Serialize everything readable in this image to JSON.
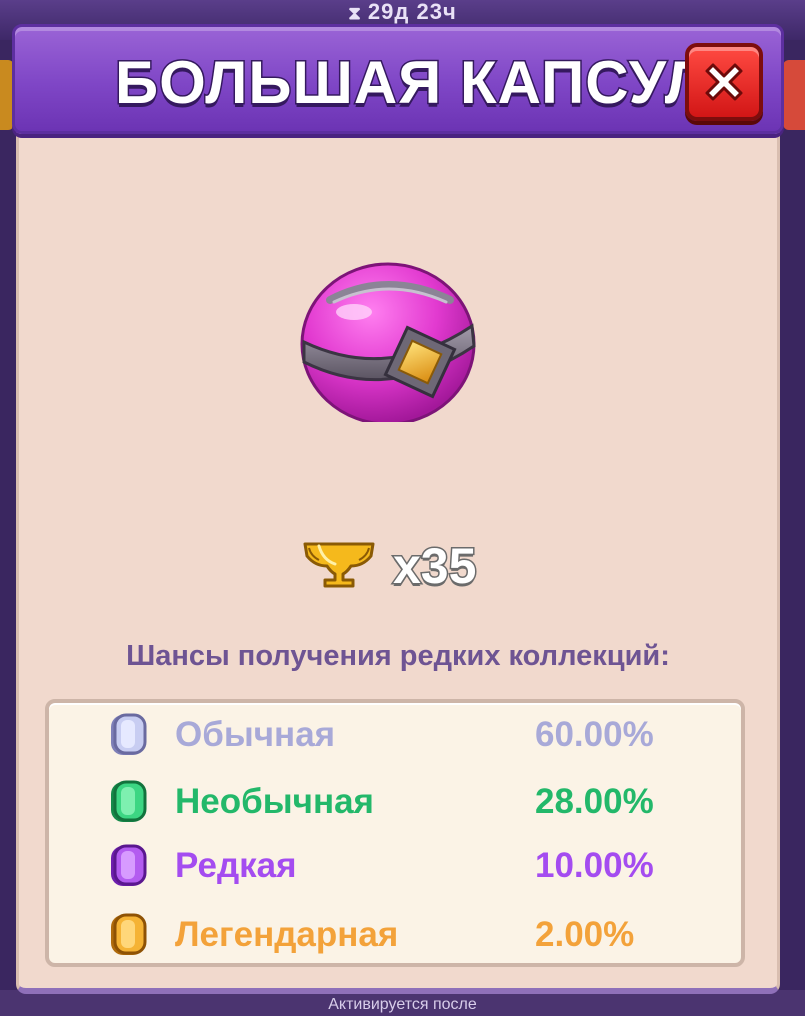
{
  "background": {
    "timer_text": "29д 23ч",
    "bottom_text": "Активируется после"
  },
  "modal": {
    "title": "БОЛЬШАЯ КАПСУЛА",
    "close_icon": "close-x-icon",
    "item_icon": "capsule-icon",
    "reward": {
      "icon": "trophy-icon",
      "count_label": "x35"
    },
    "chances_heading": "Шансы получения редких коллекций:",
    "rarities": [
      {
        "name": "Обычная",
        "chance": "60.00%",
        "color": "#a8a9d8",
        "gem_color": "#c8cdf2",
        "icon": "gem-common-icon"
      },
      {
        "name": "Необычная",
        "chance": "28.00%",
        "color": "#23b86a",
        "gem_color": "#3cd683",
        "icon": "gem-uncommon-icon"
      },
      {
        "name": "Редкая",
        "chance": "10.00%",
        "color": "#a44cf0",
        "gem_color": "#b35cf0",
        "icon": "gem-rare-icon"
      },
      {
        "name": "Легендарная",
        "chance": "2.00%",
        "color": "#f3a23a",
        "gem_color": "#f5b335",
        "icon": "gem-legendary-icon"
      }
    ]
  },
  "colors": {
    "header_purple": "#8450c8",
    "panel_bg": "#f1d9cd",
    "close_red": "#e02020",
    "heading_purple": "#6e5493"
  }
}
